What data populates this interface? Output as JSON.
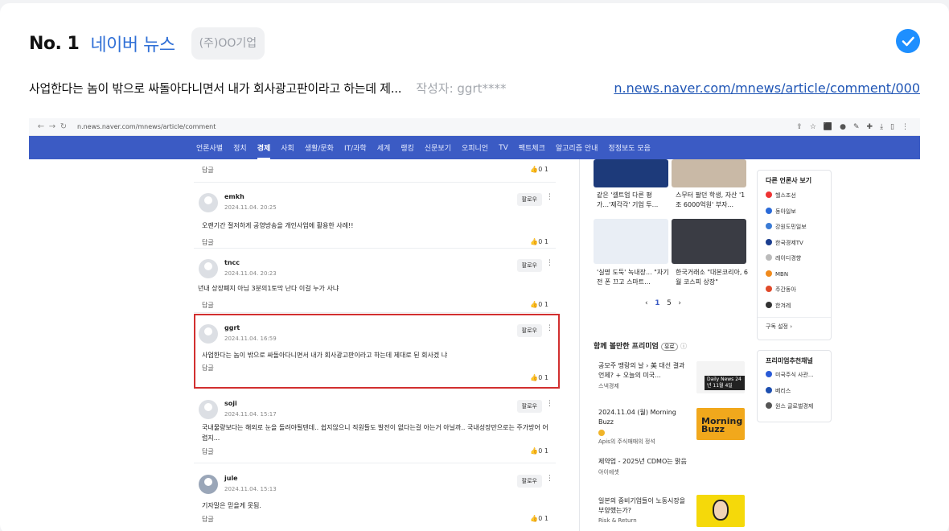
{
  "header": {
    "rank": "No. 1",
    "site_name": "네이버 뉴스",
    "company_tag": "(주)OO기업"
  },
  "item": {
    "excerpt": "사업한다는 놈이 밖으로 싸돌아다니면서 내가 회사광고판이라고 하는데 제...",
    "author": "작성자: ggrt****",
    "link": "n.news.naver.com/mnews/article/comment/000"
  },
  "browser": {
    "url": "n.news.naver.com/mnews/article/comment"
  },
  "nav": {
    "items": [
      "언론사별",
      "정치",
      "경제",
      "사회",
      "생활/문화",
      "IT/과학",
      "세계",
      "랭킹",
      "신문보기",
      "오피니언",
      "TV",
      "팩트체크",
      "알고리즘 안내",
      "정정보도 모음"
    ],
    "active_index": 2
  },
  "comments": {
    "top_reply": "답글",
    "top_votes": "0  1",
    "list": [
      {
        "name": "emkh",
        "date": "2024.11.04. 20:25",
        "text": "오랜기간 절저하게 공영방송을 개인사업에 활용한 사례!!",
        "reply": "답글",
        "votes": "0  1",
        "follow": "팔로우"
      },
      {
        "name": "tncc",
        "date": "2024.11.04. 20:23",
        "text": "년내 상장폐지 아님 3분의1토막 난다 이걸 누가 사냐",
        "reply": "답글",
        "votes": "0  1",
        "follow": "팔로우"
      },
      {
        "name": "ggrt",
        "date": "2024.11.04. 16:59",
        "text": "사업한다는 놈이 밖으로 싸돌아다니면서 내가 회사광고판이라고 하는데 제대로 된 회사겠 냐",
        "reply": "답글",
        "votes": "0  1",
        "follow": "팔로우"
      },
      {
        "name": "soji",
        "date": "2024.11.04. 15:17",
        "text": "국내물량보다는 해외로 눈을 돌려야될텐데.. 쉽지않으니 직원들도 발전이 없다는걸 아는거 아닐까.. 국내성장만으로는 주가방어 어렵지...",
        "reply": "답글",
        "votes": "0  1",
        "follow": "팔로우"
      },
      {
        "name": "jule",
        "date": "2024.11.04. 15:13",
        "text": "기자말은 믿을게 못됨.",
        "reply": "답글",
        "votes": "0  1",
        "follow": "팔로우"
      }
    ]
  },
  "news_cards": [
    {
      "caption": "같은 '셀트업 다른 평가...'제각각' 기업 투..."
    },
    {
      "caption": "스무터 팔던 학생, 자산 '1조 6000억원' 부자..."
    },
    {
      "caption": "'실명 도둑' 녹내장... \"자기 전 폰 끄고 스마트..."
    },
    {
      "caption": "한국거래소 \"대본코리아, 6월 코스피 상장\""
    }
  ],
  "pager": {
    "current": "1",
    "total": "5"
  },
  "premium": {
    "title": "함께 볼만한 프리미엄",
    "badge": "유료",
    "items": [
      {
        "title": "공모주 맹랑의 날 › 美 대선 결과 언제? + 오늘의 미국...",
        "source": "스낵경제",
        "img_text": "Daily News 24년 11월 4일"
      },
      {
        "title": "2024.11.04 (월) Morning Buzz",
        "source": "Apis의 주식매매의 정석",
        "img_text": "Morning Buzz"
      },
      {
        "title": "제약업 - 2025년 CDMO는 맑음",
        "source": "아이에셋",
        "img_text": ""
      },
      {
        "title": "일본의 중비기업들이 노동시장을 부양했는가?",
        "source": "Risk & Return",
        "img_text": ""
      }
    ]
  },
  "press": {
    "title": "다른 언론사 보기",
    "items": [
      "헬스조선",
      "동아일보",
      "강원도민일보",
      "한국경제TV",
      "레이디경향",
      "MBN",
      "주간동아",
      "한겨레"
    ],
    "footer": "구독 설정 ›"
  },
  "recommend": {
    "title": "프리미엄추천채널",
    "items": [
      "미국주식 사관...",
      "베리스",
      "원스 글로벌경제"
    ]
  },
  "colors": {
    "accent": "#2f6fd6",
    "nav_bg": "#3b5bc4",
    "highlight": "#d22f2f",
    "check": "#1e8fff"
  }
}
